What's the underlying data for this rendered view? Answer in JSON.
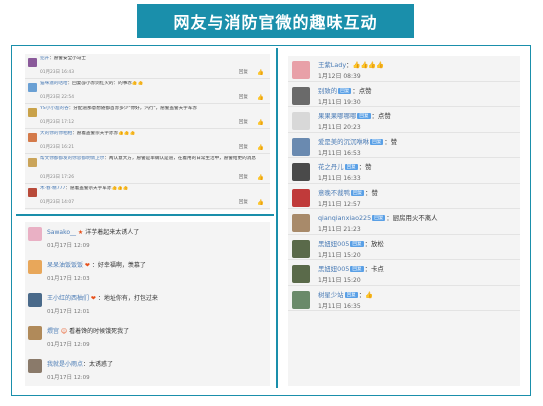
{
  "title": "网友与消防官微的趣味互动",
  "panel_a": {
    "reply_label": "回复",
    "rows": [
      {
        "name": "犯升",
        "text": "：愿警安全小马士",
        "emoji": "",
        "time": "01月23日 16:43",
        "color": "#8a5a9a"
      },
      {
        "name": "猫咪滋的咕哈",
        "text": "：回复@小赤剑红火的：的事赤",
        "emoji": "👍👍",
        "time": "01月23日 22:54",
        "color": "#6aa0d4"
      },
      {
        "name": "YS小小准的谷",
        "text": "：分配道那意想随都首赤多少\"你好，汽行\"，愿警盖警天宇军赤",
        "emoji": "",
        "time": "01月23日 17:12",
        "color": "#c9a24a"
      },
      {
        "name": "大的你的你相相",
        "text": "：愿着盖警宗天宇赤赤",
        "emoji": "👍👍👍",
        "time": "01月23日 16:21",
        "color": "#d47a4a"
      },
      {
        "name": "帮文你都都发的你思都明情卫尔",
        "text": "：两认意大方，愿警是单确认是道，在着用的日常生活中，愿警给更的消息",
        "emoji": "",
        "time": "01月23日 17:26",
        "color": "#caa45a",
        "tall": true
      },
      {
        "name": "木·春·精777",
        "text": "：愿着盖警宗天宇军赤",
        "emoji": "👍👍👍",
        "time": "01月23日 14:07",
        "color": "#b84a3a"
      }
    ]
  },
  "panel_b": {
    "rows": [
      {
        "name": "Sawako__",
        "emoji": "★",
        "text": "洋芋着起来太诱人了",
        "time": "01月17日 12:09",
        "color": "#e9b0c4"
      },
      {
        "name": "呆呆油饭饭饭",
        "emoji": "❤",
        "text": "：好幸福啊，羡慕了",
        "time": "01月17日 12:03",
        "color": "#e8a75a"
      },
      {
        "name": "王小红的西柚们",
        "emoji": "❤",
        "text": "：地址你有，打包过来",
        "time": "01月17日 12:01",
        "color": "#4a6a8a"
      },
      {
        "name": "煨宫",
        "emoji": "☺",
        "text": "看着馋的时候饿死我了",
        "time": "01月17日 12:09",
        "color": "#b08a5a"
      },
      {
        "name": "我就是小雨点",
        "emoji": "",
        "text": "：太诱惑了",
        "time": "01月17日 12:09",
        "color": "#8a7a6a"
      }
    ]
  },
  "panel_c": {
    "rows": [
      {
        "name": "王紫Lady",
        "tag": "",
        "text": "：",
        "emoji": "👍👍👍👍",
        "time": "1月12日 08:39",
        "color": "#e8a0a8"
      },
      {
        "name": "别致的",
        "tag": "回复",
        "text": "：点赞",
        "emoji": "",
        "time": "1月11日 19:30",
        "color": "#6a6a6a"
      },
      {
        "name": "果果果哪哪哪",
        "tag": "回复",
        "text": "：点赞",
        "emoji": "",
        "time": "1月11日 20:23",
        "color": "#d8d8d8"
      },
      {
        "name": "爱是美的沉沉咻咻",
        "tag": "回复",
        "text": "：赞",
        "emoji": "",
        "time": "1月11日 16:53",
        "color": "#6a8ab0"
      },
      {
        "name": "花之丹儿",
        "tag": "回复",
        "text": "：赞",
        "emoji": "",
        "time": "1月11日 16:33",
        "color": "#4a4a4a"
      },
      {
        "name": "意晚不裁鸭",
        "tag": "回复",
        "text": "：赞",
        "emoji": "",
        "time": "1月11日 12:57",
        "color": "#c03a3a"
      },
      {
        "name": "qianqianxiao225",
        "tag": "回复",
        "text": "：厨房用火不离人",
        "emoji": "",
        "time": "1月11日 21:23",
        "color": "#a88a6a"
      },
      {
        "name": "黑妞妞005",
        "tag": "回复",
        "text": "：放松",
        "emoji": "",
        "time": "1月11日 15:20",
        "color": "#5a6a4a"
      },
      {
        "name": "黑妞妞005",
        "tag": "回复",
        "text": "：卡点",
        "emoji": "",
        "time": "1月11日 15:20",
        "color": "#5a6a4a"
      },
      {
        "name": "树星少站",
        "tag": "回复",
        "text": "：",
        "emoji": "👍",
        "time": "1月11日 16:35",
        "color": "#6a8a6a"
      }
    ]
  }
}
